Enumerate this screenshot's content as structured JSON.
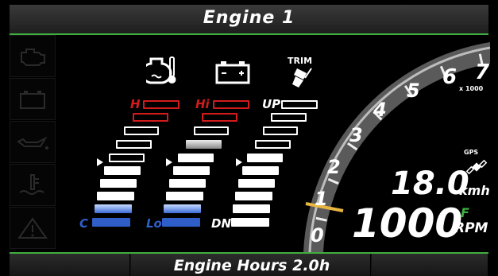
{
  "header": {
    "title": "Engine 1"
  },
  "sidebar": {
    "items": [
      {
        "icon": "check-engine-icon"
      },
      {
        "icon": "battery-icon"
      },
      {
        "icon": "oil-pressure-icon"
      },
      {
        "icon": "coolant-temperature-icon"
      },
      {
        "icon": "warning-icon"
      }
    ]
  },
  "gauges": {
    "temperature": {
      "icon": "engine-temperature-icon",
      "high_label": "H",
      "low_label": "C"
    },
    "voltage": {
      "icon": "battery-icon",
      "high_label": "Hi",
      "low_label": "Lo"
    },
    "trim": {
      "icon": "trim-icon",
      "title": "TRIM",
      "high_label": "UP",
      "low_label": "DN"
    }
  },
  "tachometer": {
    "scale_labels": [
      "0",
      "1",
      "2",
      "3",
      "4",
      "5",
      "6",
      "7"
    ],
    "multiplier": "x 1000",
    "needle_value": 1
  },
  "speed": {
    "value": "18.0",
    "unit": "kmh",
    "source": "GPS",
    "icon": "satellite-icon"
  },
  "rpm": {
    "value": "1000",
    "unit": "RPM",
    "gear": "F"
  },
  "footer": {
    "text": "Engine Hours 2.0h"
  },
  "colors": {
    "accent": "#3fae3f",
    "red": "#d21c1c",
    "blue": "#2f5ec8",
    "needle": "#e8b640"
  }
}
